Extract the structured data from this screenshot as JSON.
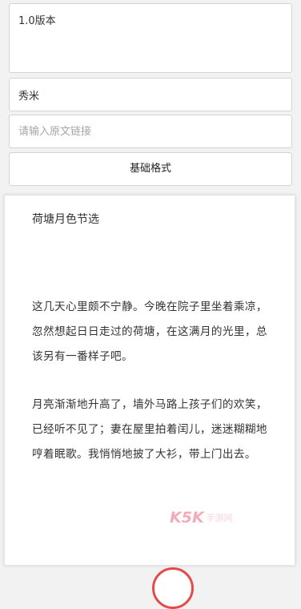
{
  "form": {
    "version_value": "1.0版本",
    "author_value": "秀米",
    "link_placeholder": "请输入原文链接",
    "format_button_label": "基础格式"
  },
  "article": {
    "title": "荷塘月色节选",
    "paragraphs": [
      "这几天心里颇不宁静。今晚在院子里坐着乘凉，忽然想起日日走过的荷塘，在这满月的光里，总该另有一番样子吧。",
      "月亮渐渐地升高了，墙外马路上孩子们的欢笑，已经听不见了；妻在屋里拍着闰儿，迷迷糊糊地哼着眠歌。我悄悄地披了大衫，带上门出去。"
    ]
  },
  "watermark": {
    "letters": "K5K",
    "subtitle": "手游网"
  },
  "colors": {
    "accent_red": "#e34a4a",
    "watermark_pink": "#f3b8c2"
  }
}
